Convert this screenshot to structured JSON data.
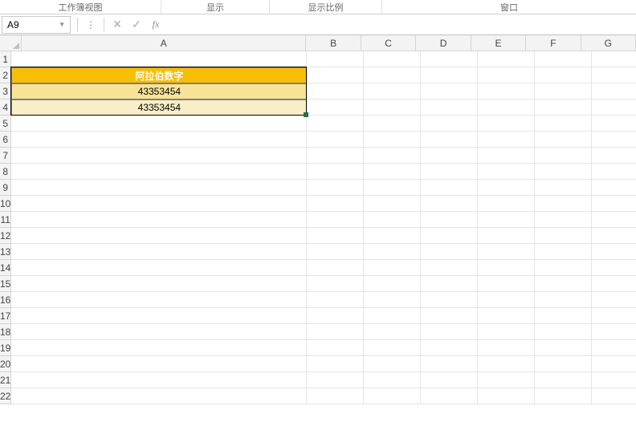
{
  "ribbon": {
    "group1": "工作簿视图",
    "group2": "显示",
    "group3": "显示比例",
    "group4": "窗口"
  },
  "formula_bar": {
    "name_box": "A9",
    "cancel": "✕",
    "confirm": "✓",
    "fx": "fx",
    "value": ""
  },
  "columns": [
    "A",
    "B",
    "C",
    "D",
    "E",
    "F",
    "G"
  ],
  "rows": [
    "1",
    "2",
    "3",
    "4",
    "5",
    "6",
    "7",
    "8",
    "9",
    "10",
    "11",
    "12",
    "13",
    "14",
    "15",
    "16",
    "17",
    "18",
    "19",
    "20",
    "21",
    "22"
  ],
  "cells": {
    "A2": "阿拉伯数字",
    "A3": "43353454",
    "A4": "43353454"
  },
  "selection": {
    "cell": "A9"
  }
}
